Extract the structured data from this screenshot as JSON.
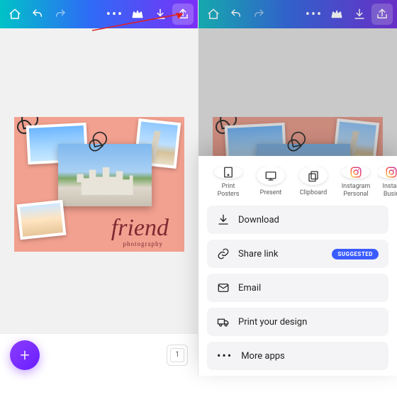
{
  "design": {
    "title": "friend",
    "subtitle": "photography"
  },
  "left": {
    "page_count": "1"
  },
  "share_targets": [
    {
      "label": "Print\nPosters"
    },
    {
      "label": "Present"
    },
    {
      "label": "Clipboard"
    },
    {
      "label": "Instagram\nPersonal"
    },
    {
      "label": "Instag\nBusin"
    }
  ],
  "actions": {
    "download": "Download",
    "share_link": "Share link",
    "share_link_badge": "SUGGESTED",
    "email": "Email",
    "print": "Print your design",
    "more": "More apps"
  }
}
